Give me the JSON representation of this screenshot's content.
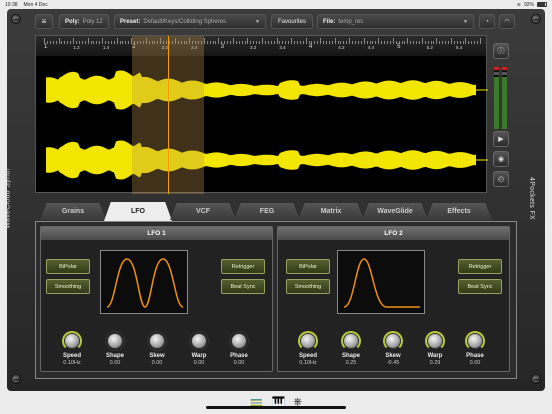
{
  "statusbar": {
    "time": "10:38",
    "date": "Mon 4 Dec",
    "battery": "92%"
  },
  "sidebar": {
    "left_title": "WaveCloud Synth",
    "right_title": "4Pockets FX"
  },
  "toolbar": {
    "poly_label": "Poly:",
    "poly_value": "Poly 12",
    "preset_label": "Preset:",
    "preset_value": "Default/Keys/Colliding Spheres",
    "favourites_label": "Favourites",
    "file_label": "File:",
    "file_value": "temp_rec"
  },
  "ruler": {
    "labels": [
      "1",
      "1.2",
      "1.4",
      "2",
      "2.2",
      "2.4",
      "3",
      "3.2",
      "3.4",
      "4",
      "4.2",
      "4.4",
      "5",
      "5.2",
      "5.4"
    ]
  },
  "tabs": [
    {
      "label": "Grains"
    },
    {
      "label": "LFO"
    },
    {
      "label": "VCF"
    },
    {
      "label": "FEG"
    },
    {
      "label": "Matrix"
    },
    {
      "label": "WaveGlide"
    },
    {
      "label": "Effects"
    }
  ],
  "lfo1": {
    "title": "LFO 1",
    "bipolar": "BiPolar",
    "smoothing": "Smoothing",
    "retrigger": "Retrigger",
    "beat_sync": "Beat Sync",
    "knobs": [
      {
        "label": "Speed",
        "value": "0.10Hz"
      },
      {
        "label": "Shape",
        "value": "0.00"
      },
      {
        "label": "Skew",
        "value": "0.00"
      },
      {
        "label": "Warp",
        "value": "0.00"
      },
      {
        "label": "Phase",
        "value": "0.00"
      }
    ]
  },
  "lfo2": {
    "title": "LFO 2",
    "bipolar": "BiPolar",
    "smoothing": "Smoothing",
    "retrigger": "Retrigger",
    "beat_sync": "Beat Sync",
    "knobs": [
      {
        "label": "Speed",
        "value": "0.10Hz"
      },
      {
        "label": "Shape",
        "value": "0.25"
      },
      {
        "label": "Skew",
        "value": "-0.45"
      },
      {
        "label": "Warp",
        "value": "0.29"
      },
      {
        "label": "Phase",
        "value": "0.00"
      }
    ]
  },
  "icons": {
    "menu": "menu-icon",
    "info": "info-icon",
    "play": "play-icon",
    "record": "record-icon",
    "dial": "dial-icon",
    "gauge": "gauge-icon"
  },
  "colors": {
    "waveform": "#f2e600",
    "playhead": "#f0a000",
    "lfo_curve": "#f09010",
    "button_accent": "#9aa060"
  },
  "dock": {
    "items": [
      "train-icon",
      "piano-icon",
      "midi-icon"
    ]
  }
}
